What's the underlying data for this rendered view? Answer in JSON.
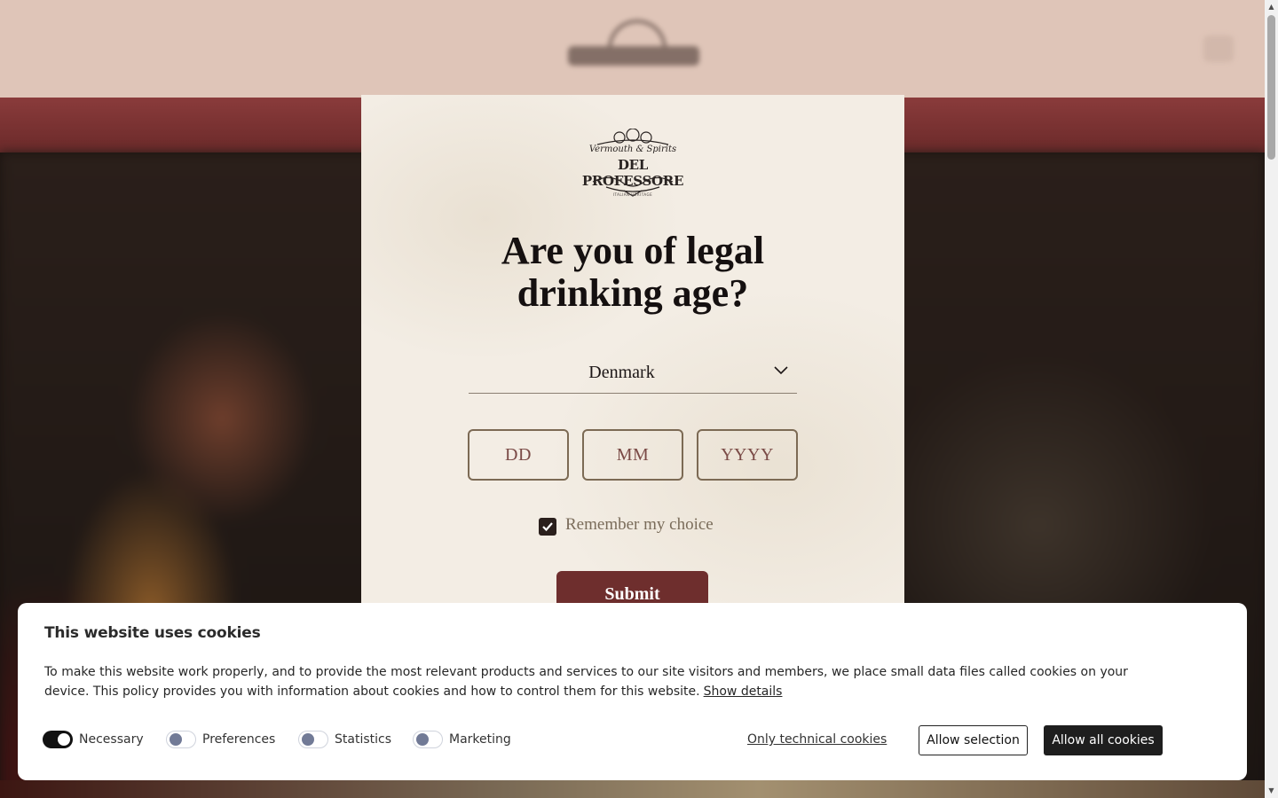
{
  "site": {
    "scrollbar": {
      "up": "▲",
      "down": "▼"
    }
  },
  "age_gate": {
    "brand": {
      "tagline": "Vermouth & Spirits",
      "name": "DEL PROFESSORE",
      "subtitle": "ITALIAN HERITAGE"
    },
    "title": "Are you of legal drinking age?",
    "country": {
      "selected": "Denmark",
      "icon": "chevron-down-icon"
    },
    "date": {
      "day_placeholder": "DD",
      "month_placeholder": "MM",
      "year_placeholder": "YYYY"
    },
    "remember": {
      "label": "Remember my choice",
      "checked": true
    },
    "submit_label": "Submit",
    "colors": {
      "accent": "#6e2e2d",
      "paper": "#f3ede4"
    }
  },
  "cookie_banner": {
    "title": "This website uses cookies",
    "body": "To make this website work properly, and to provide the most relevant products and services to our site visitors and members, we place small data files called cookies on your device. This policy provides you with information about cookies and how to control them for this website.",
    "show_details": "Show details",
    "toggles": [
      {
        "label": "Necessary",
        "on": true
      },
      {
        "label": "Preferences",
        "on": false
      },
      {
        "label": "Statistics",
        "on": false
      },
      {
        "label": "Marketing",
        "on": false
      }
    ],
    "only_technical": "Only technical cookies",
    "allow_selection": "Allow selection",
    "allow_all": "Allow all cookies"
  }
}
